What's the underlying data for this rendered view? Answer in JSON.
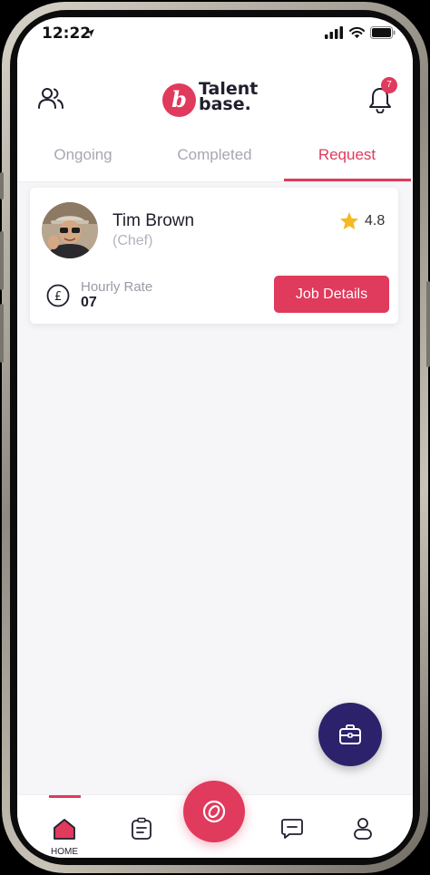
{
  "status_bar": {
    "time": "12:22"
  },
  "brand": {
    "mark": "b",
    "line1": "Talent",
    "line2": "base."
  },
  "notifications": {
    "count": "7"
  },
  "tabs": [
    {
      "label": "Ongoing",
      "active": false
    },
    {
      "label": "Completed",
      "active": false
    },
    {
      "label": "Request",
      "active": true
    }
  ],
  "request_card": {
    "name": "Tim Brown",
    "role": "(Chef)",
    "rating": "4.8",
    "rate_label": "Hourly Rate",
    "rate_value": "07",
    "button_label": "Job Details"
  },
  "bottom_nav": {
    "home_label": "HOME"
  },
  "colors": {
    "accent": "#e03a5c",
    "fab": "#2b226b",
    "star": "#f5b921"
  }
}
